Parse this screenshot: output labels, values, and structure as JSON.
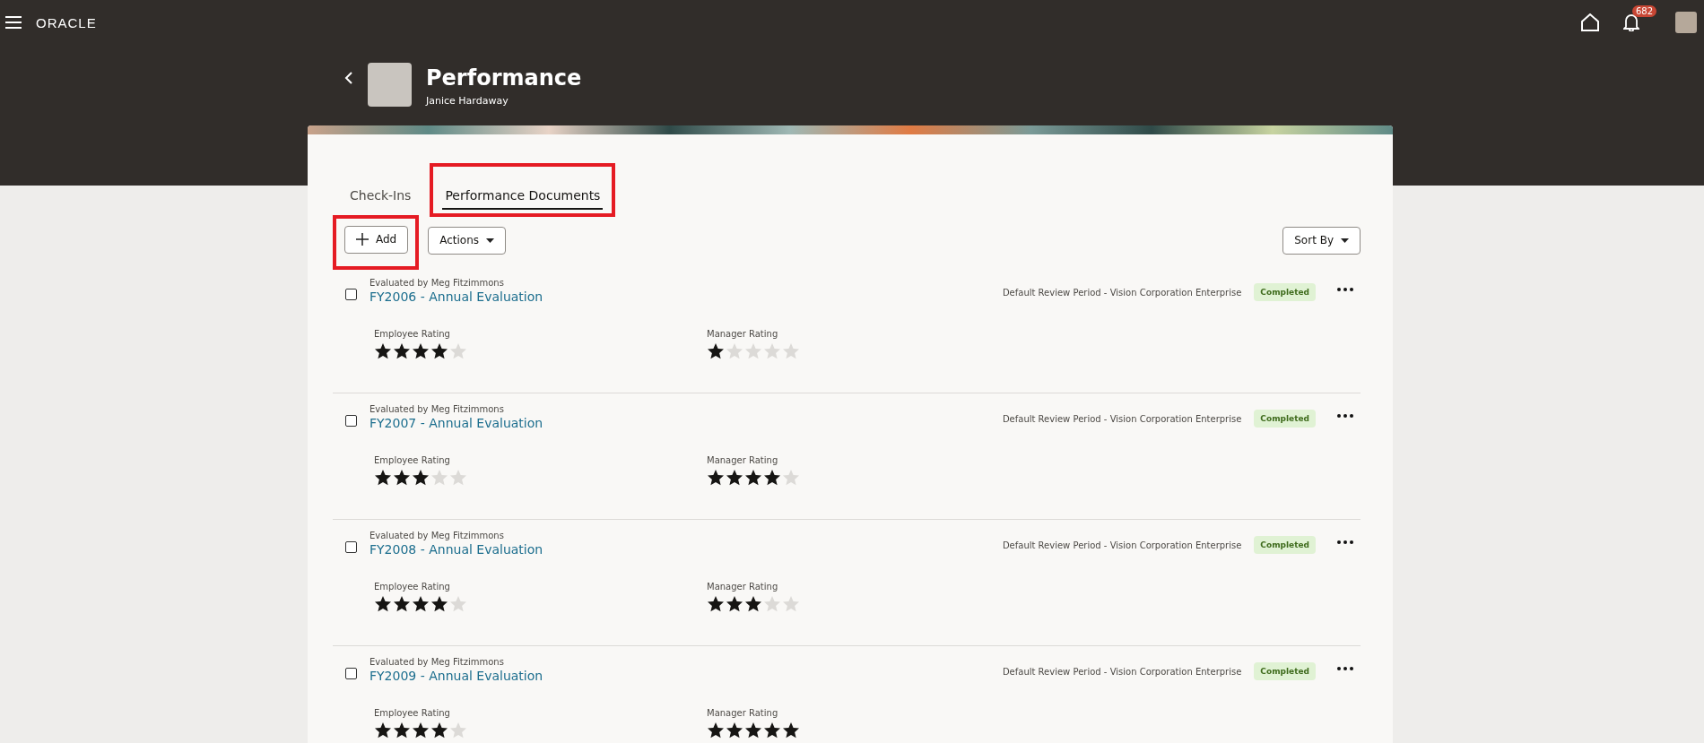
{
  "top_bar": {
    "logo": "ORACLE",
    "notifications": {
      "count": "682"
    }
  },
  "header": {
    "title": "Performance",
    "subtitle": "Janice Hardaway"
  },
  "tabs": [
    {
      "label": "Check-Ins",
      "selected": false,
      "highlighted": false
    },
    {
      "label": "Performance Documents",
      "selected": true,
      "highlighted": true
    }
  ],
  "toolbar": {
    "add": {
      "label": "Add",
      "highlighted": true
    },
    "actions": {
      "label": "Actions"
    },
    "sort": {
      "label": "Sort By"
    }
  },
  "documents": [
    {
      "evaluator": "Evaluated by Meg Fitzimmons",
      "title": "FY2006 - Annual Evaluation",
      "period": "Default Review Period - Vision Corporation Enterprise",
      "status": "Completed",
      "checked": false,
      "ratings": [
        {
          "label": "Employee Rating",
          "stars": 4
        },
        {
          "label": "Manager Rating",
          "stars": 1
        }
      ]
    },
    {
      "evaluator": "Evaluated by Meg Fitzimmons",
      "title": "FY2007 - Annual Evaluation",
      "period": "Default Review Period - Vision Corporation Enterprise",
      "status": "Completed",
      "checked": false,
      "ratings": [
        {
          "label": "Employee Rating",
          "stars": 3
        },
        {
          "label": "Manager Rating",
          "stars": 4
        }
      ]
    },
    {
      "evaluator": "Evaluated by Meg Fitzimmons",
      "title": "FY2008 - Annual Evaluation",
      "period": "Default Review Period - Vision Corporation Enterprise",
      "status": "Completed",
      "checked": false,
      "ratings": [
        {
          "label": "Employee Rating",
          "stars": 4
        },
        {
          "label": "Manager Rating",
          "stars": 3
        }
      ]
    },
    {
      "evaluator": "Evaluated by Meg Fitzimmons",
      "title": "FY2009 - Annual Evaluation",
      "period": "Default Review Period - Vision Corporation Enterprise",
      "status": "Completed",
      "checked": false,
      "ratings": [
        {
          "label": "Employee Rating",
          "stars": 4
        },
        {
          "label": "Manager Rating",
          "stars": 5
        }
      ]
    }
  ]
}
